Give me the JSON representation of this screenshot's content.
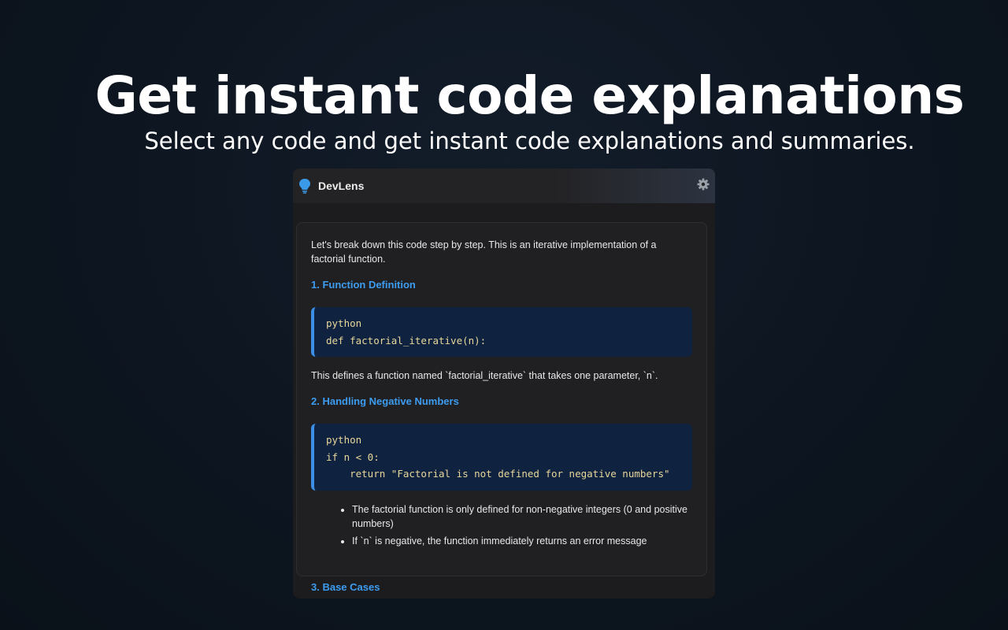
{
  "hero": {
    "title": "Get instant code explanations",
    "subtitle": "Select any code and get instant code explanations and summaries."
  },
  "extension": {
    "name": "DevLens",
    "icons": {
      "logo": "lightbulb-icon",
      "settings": "gear-icon"
    },
    "colors": {
      "accent": "#3d9cf0",
      "code_background": "#0f2340",
      "code_text": "#e8d79a"
    }
  },
  "explanation": {
    "intro": "Let's break down this code step by step. This is an iterative implementation of a factorial function.",
    "sections": [
      {
        "heading": "1. Function Definition",
        "code": "python\ndef factorial_iterative(n):",
        "text": "This defines a function named `factorial_iterative` that takes one parameter, `n`."
      },
      {
        "heading": "2. Handling Negative Numbers",
        "code": "python\nif n < 0:\n    return \"Factorial is not defined for negative numbers\"",
        "bullets": [
          "The factorial function is only defined for non-negative integers (0 and positive numbers)",
          "If `n` is negative, the function immediately returns an error message"
        ]
      }
    ],
    "next_heading": "3. Base Cases"
  }
}
